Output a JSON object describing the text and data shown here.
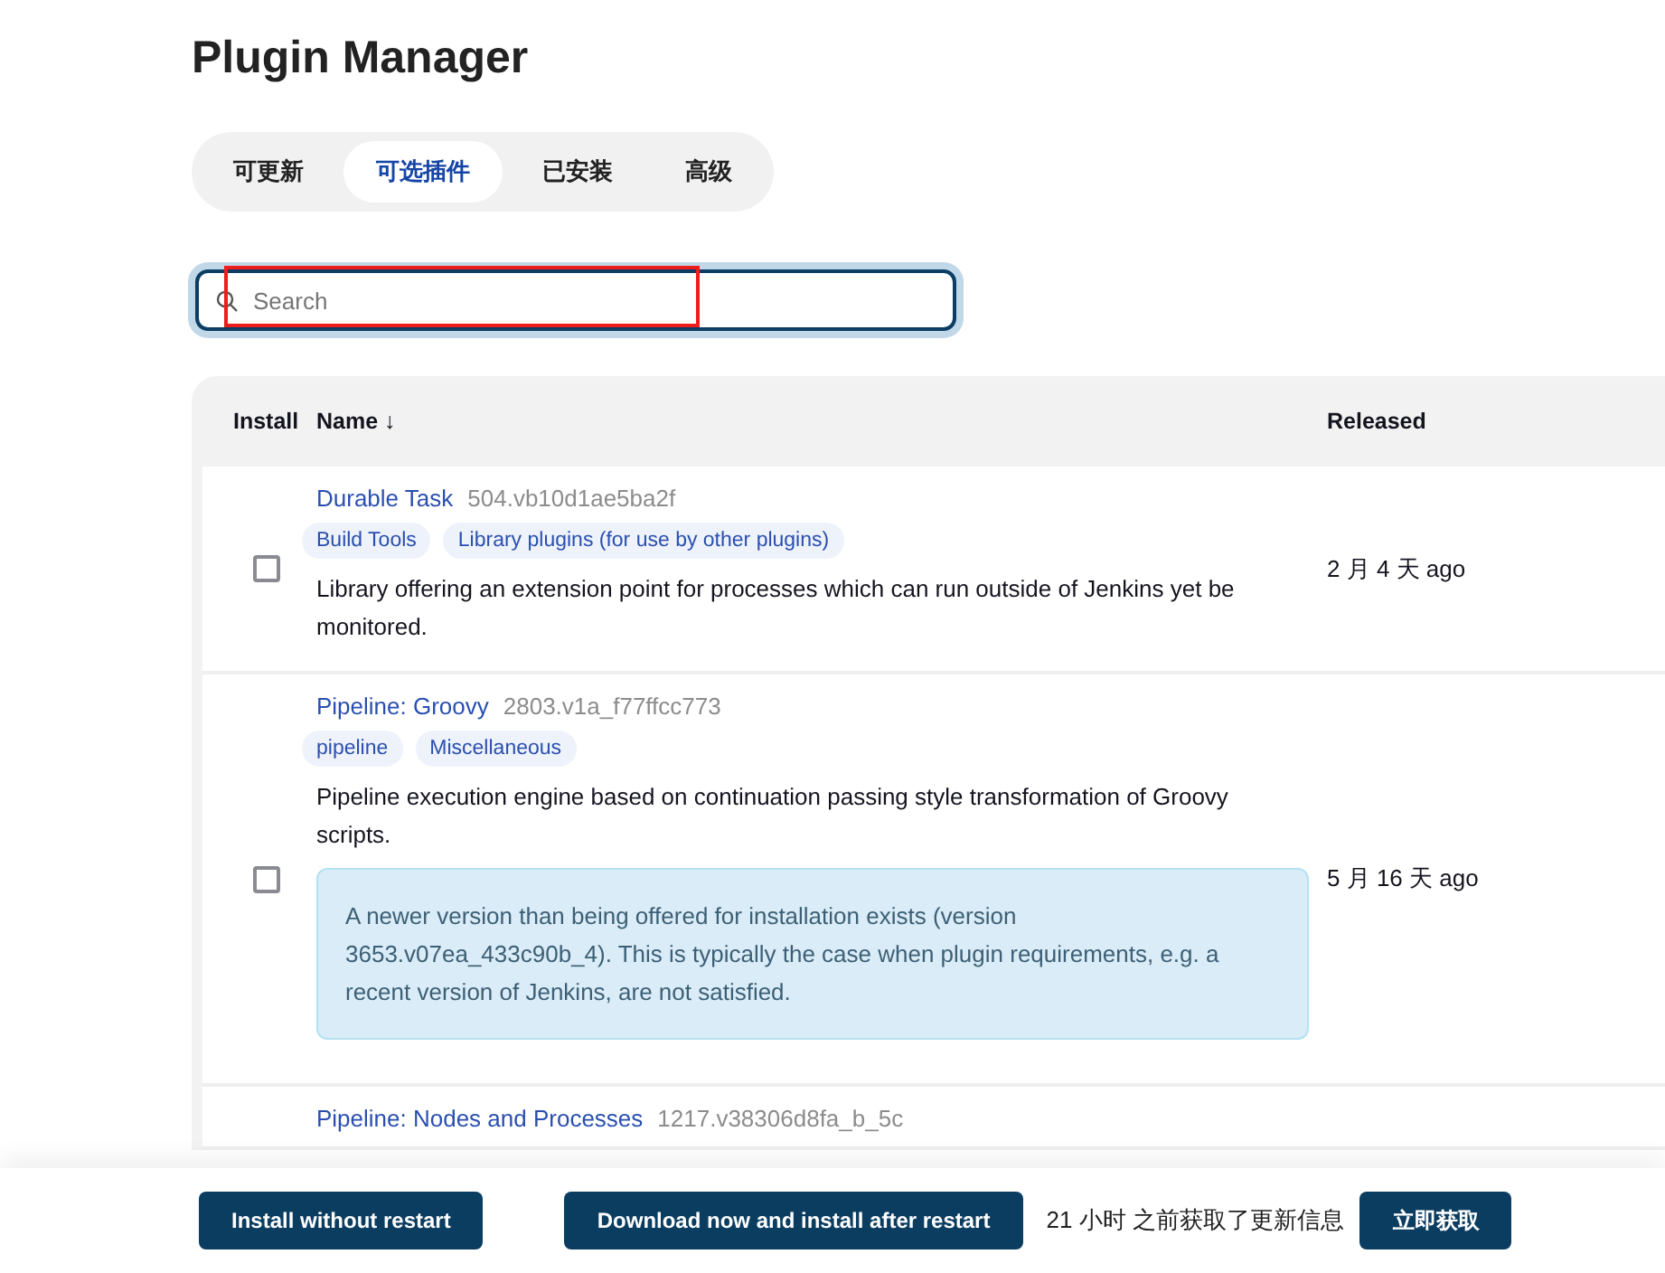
{
  "page": {
    "title": "Plugin Manager"
  },
  "tabs": [
    {
      "label": "可更新",
      "selected": false
    },
    {
      "label": "可选插件",
      "selected": true
    },
    {
      "label": "已安装",
      "selected": false
    },
    {
      "label": "高级",
      "selected": false
    }
  ],
  "search": {
    "placeholder": "Search",
    "highlighted": true
  },
  "table": {
    "columns": [
      "Install",
      "Name ↓",
      "Released"
    ],
    "rows": [
      {
        "checked": false,
        "name": "Durable Task",
        "version": "504.vb10d1ae5ba2f",
        "tags": [
          "Build Tools",
          "Library plugins (for use by other plugins)"
        ],
        "description": "Library offering an extension point for processes which can run outside of Jenkins yet be monitored.",
        "notice": null,
        "released": "2 月 4 天 ago"
      },
      {
        "checked": false,
        "name": "Pipeline: Groovy",
        "version": "2803.v1a_f77ffcc773",
        "tags": [
          "pipeline",
          "Miscellaneous"
        ],
        "description": "Pipeline execution engine based on continuation passing style transformation of Groovy scripts.",
        "notice": "A newer version than being offered for installation exists (version 3653.v07ea_433c90b_4). This is typically the case when plugin requirements, e.g. a recent version of Jenkins, are not satisfied.",
        "released": "5 月 16 天 ago"
      },
      {
        "name": "Pipeline: Nodes and Processes",
        "version": "1217.v38306d8fa_b_5c",
        "tags": [],
        "description": null,
        "notice": null,
        "released": null
      }
    ]
  },
  "footer": {
    "buttons": [
      "Install without restart",
      "Download now and install after restart"
    ],
    "status": "21 小时 之前获取了更新信息",
    "refresh_button": "立即获取"
  }
}
